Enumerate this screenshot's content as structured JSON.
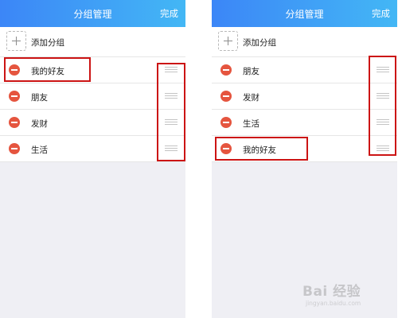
{
  "colors": {
    "header_gradient_start": "#3c86f7",
    "header_gradient_end": "#43b7f5",
    "delete_button": "#e5553f",
    "highlight_box": "#cc1414",
    "page_background": "#efeff4"
  },
  "icons": {
    "add": "plus-icon",
    "delete": "minus-circle-icon",
    "drag": "drag-handle-icon"
  },
  "panels": [
    {
      "title": "分组管理",
      "done_label": "完成",
      "add_label": "添加分组",
      "groups": [
        {
          "label": "我的好友"
        },
        {
          "label": "朋友"
        },
        {
          "label": "发财"
        },
        {
          "label": "生活"
        }
      ]
    },
    {
      "title": "分组管理",
      "done_label": "完成",
      "add_label": "添加分组",
      "groups": [
        {
          "label": "朋友"
        },
        {
          "label": "发财"
        },
        {
          "label": "生活"
        },
        {
          "label": "我的好友"
        }
      ]
    }
  ],
  "watermark": {
    "main": "Bai 经验",
    "url": "jingyan.baidu.com"
  }
}
